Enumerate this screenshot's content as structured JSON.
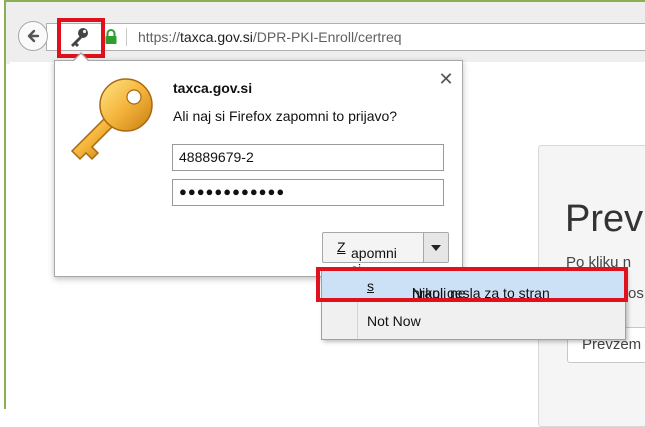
{
  "browser": {
    "url_scheme": "https://",
    "url_domain": "taxca.gov.si",
    "url_path": "/DPR-PKI-Enroll/certreq"
  },
  "page": {
    "heading": "Prev",
    "text_line1": "Po kliku n",
    "text_line2": "os",
    "button_label": "Prevzem"
  },
  "password_prompt": {
    "site": "taxca.gov.si",
    "question": "Ali naj si Firefox zapomni to prijavo?",
    "username": "48889679-2",
    "password_mask": "●●●●●●●●●●●●",
    "close_label": "✕",
    "remember_pre": "",
    "remember_accel": "Z",
    "remember_post": "apomni si"
  },
  "dropdown_menu": {
    "never_pre": "Nikoli ne ",
    "never_accel": "s",
    "never_post": "hrani gesla za to stran",
    "not_now": "Not Now"
  },
  "colors": {
    "highlight_red": "#e0101c",
    "window_border_green": "#8cae54",
    "lock_green": "#2e9e2e",
    "menu_highlight": "#cce0f6"
  }
}
